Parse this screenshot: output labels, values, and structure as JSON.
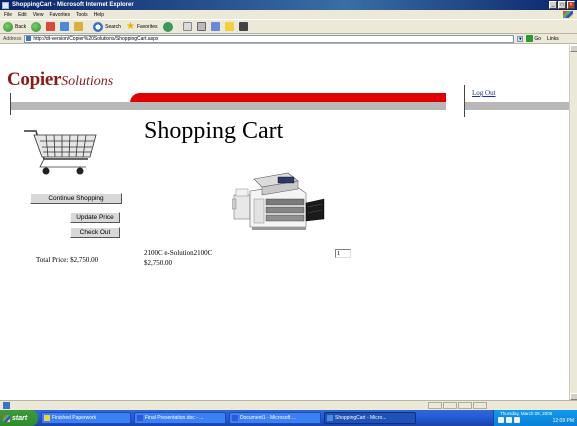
{
  "window": {
    "title": "ShoppingCart - Microsoft Internet Explorer",
    "controls": [
      "_",
      "□",
      "×"
    ]
  },
  "menu": [
    "File",
    "Edit",
    "View",
    "Favorites",
    "Tools",
    "Help"
  ],
  "toolbar": {
    "back_label": "Back",
    "search_label": "Search",
    "favorites_label": "Favorites"
  },
  "address": {
    "label": "Address",
    "url": "http://dt-version/Copier%20Solutions/ShoppingCart.aspx",
    "go_label": "Go",
    "links_label": "Links"
  },
  "site": {
    "logo_main": "Copier",
    "logo_sub": "Solutions",
    "logout_label": "Log Out"
  },
  "page": {
    "title": "Shopping Cart",
    "buttons": {
      "continue": "Continue Shopping",
      "update": "Update Price",
      "checkout": "Check Out"
    },
    "total": "Total Price: $2,750.00",
    "item": {
      "name": "2100C e-Solution2100C",
      "price": "$2,750.00",
      "quantity": "1"
    }
  },
  "taskbar": {
    "start_label": "start",
    "tasks": [
      "Finished Paperwork",
      "Final Presentation.doc - ...",
      "Document1 - Microsoft ...",
      "ShoppingCart - Micro..."
    ],
    "date": "Thursday, March 09, 2006",
    "clock": "12:09 PM"
  },
  "colors": {
    "brand": "#8b1a1a",
    "banner_red": "#e00000",
    "banner_gray": "#b8b8b8",
    "link": "#1a2ea0"
  }
}
